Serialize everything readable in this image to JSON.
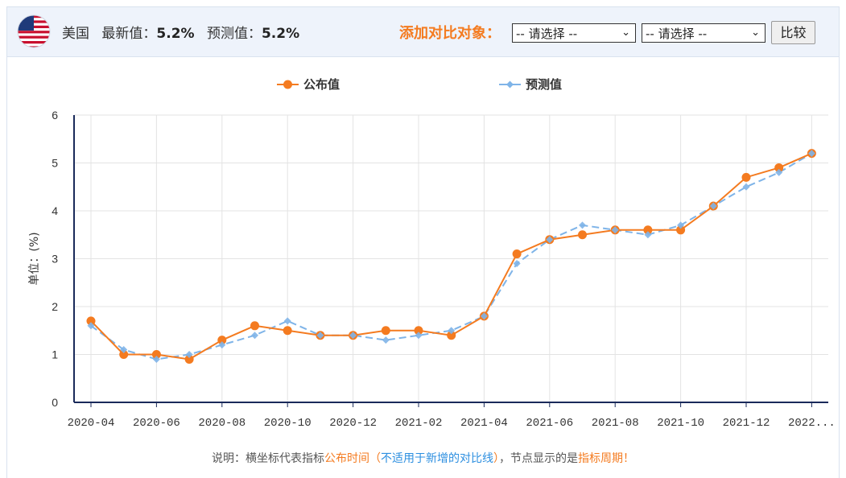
{
  "header": {
    "country": "美国",
    "latest_label": "最新值：",
    "latest_value": "5.2%",
    "forecast_label": "预测值：",
    "forecast_value": "5.2%",
    "compare_label": "添加对比对象：",
    "select1": "-- 请选择 --",
    "select2": "-- 请选择 --",
    "compare_button": "比较",
    "flag_icon": "us-flag-icon"
  },
  "note": {
    "prefix": "说明：横坐标代表指标",
    "orange1": "公布时间",
    "paren_open": "（",
    "blue": "不适用于新增的对比线",
    "paren_close": "）",
    "middle": "，节点显示的是",
    "orange2": "指标周期",
    "suffix": "！"
  },
  "colors": {
    "published": "#f47b20",
    "forecast": "#7fb4e8",
    "axis": "#1a2a5a",
    "grid": "#e3e3e3"
  },
  "chart_data": {
    "type": "line",
    "title": "",
    "xlabel": "",
    "ylabel": "单位：(%)",
    "ylim": [
      0,
      6
    ],
    "yticks": [
      0,
      1,
      2,
      3,
      4,
      5,
      6
    ],
    "x": [
      "2020-04",
      "2020-05",
      "2020-06",
      "2020-07",
      "2020-08",
      "2020-09",
      "2020-10",
      "2020-11",
      "2020-12",
      "2021-01",
      "2021-02",
      "2021-03",
      "2021-04",
      "2021-05",
      "2021-06",
      "2021-07",
      "2021-08",
      "2021-09",
      "2021-10",
      "2021-11",
      "2021-12",
      "2022-01",
      "2022-02"
    ],
    "xtick_labels": [
      "2020-04",
      "2020-06",
      "2020-08",
      "2020-10",
      "2020-12",
      "2021-02",
      "2021-04",
      "2021-06",
      "2021-08",
      "2021-10",
      "2021-12",
      "2022..."
    ],
    "legend_position": "top-center",
    "grid": true,
    "series": [
      {
        "name": "公布值",
        "style": "solid-circle",
        "values": [
          1.7,
          1.0,
          1.0,
          0.9,
          1.3,
          1.6,
          1.5,
          1.4,
          1.4,
          1.5,
          1.5,
          1.4,
          1.8,
          3.1,
          3.4,
          3.5,
          3.6,
          3.6,
          3.6,
          4.1,
          4.7,
          4.9,
          5.2
        ]
      },
      {
        "name": "预测值",
        "style": "dashed-diamond",
        "values": [
          1.6,
          1.1,
          0.9,
          1.0,
          1.2,
          1.4,
          1.7,
          1.4,
          1.4,
          1.3,
          1.4,
          1.5,
          1.8,
          2.9,
          3.4,
          3.7,
          3.6,
          3.5,
          3.7,
          4.1,
          4.5,
          4.8,
          5.2
        ]
      }
    ]
  }
}
